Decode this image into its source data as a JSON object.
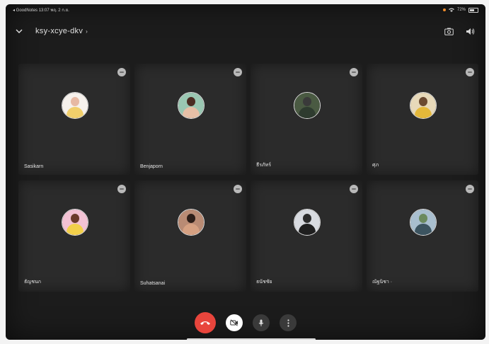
{
  "statusbar": {
    "left": "◂ GoodNotes  13:07  พฤ. 2 ก.ย.",
    "right": "72%"
  },
  "header": {
    "meeting_code": "ksy-xcye-dkv",
    "caret": "›"
  },
  "participants": [
    {
      "name": "Sasikarn",
      "bg": "#f6f1ec",
      "head": "#e7b9a3",
      "body": "#f1cf6b"
    },
    {
      "name": "Benjaporn",
      "bg": "#9ac7b2",
      "head": "#4b2c22",
      "body": "#e6bfa6"
    },
    {
      "name": "ธีรภัทร์",
      "bg": "#4a5a42",
      "head": "#3a3a3a",
      "body": "#2e3b2f"
    },
    {
      "name": "ศุภ",
      "bg": "#e7d9b9",
      "head": "#6b4a31",
      "body": "#e4b83a"
    },
    {
      "name": "ธัญชนก",
      "bg": "#f3c2d4",
      "head": "#6b3b2b",
      "body": "#f2d04a"
    },
    {
      "name": "Suhatsanai",
      "bg": "#b98b74",
      "head": "#2d1e18",
      "body": "#d6a182"
    },
    {
      "name": "ธนัชชัย",
      "bg": "#d8dbe0",
      "head": "#2c2c2c",
      "body": "#1f1f1f"
    },
    {
      "name": "ณัฐนิชา ·",
      "bg": "#a9bfcf",
      "head": "#6b8a5e",
      "body": "#3c5460"
    }
  ],
  "colors": {
    "end_call": "#e8453c",
    "ctrl_light": "#ffffff",
    "ctrl_dark": "#3a3a3a"
  }
}
